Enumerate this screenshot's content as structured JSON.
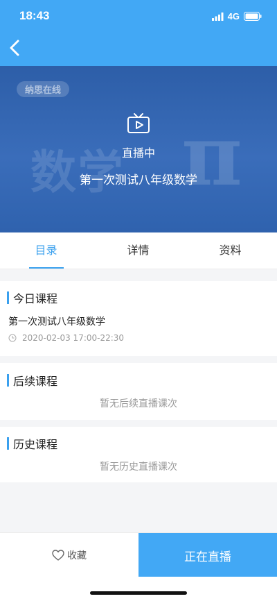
{
  "status_bar": {
    "time": "18:43",
    "network": "4G"
  },
  "banner": {
    "brand": "纳思在线",
    "subject_bg": "数学",
    "symbol_bg": "π",
    "live_label": "直播中",
    "title": "第一次测试八年级数学"
  },
  "tabs": [
    {
      "label": "目录",
      "active": true
    },
    {
      "label": "详情",
      "active": false
    },
    {
      "label": "资料",
      "active": false
    }
  ],
  "today": {
    "title": "今日课程",
    "course_name": "第一次测试八年级数学",
    "course_time": "2020-02-03  17:00-22:30"
  },
  "upcoming": {
    "title": "后续课程",
    "empty_text": "暂无后续直播课次"
  },
  "history": {
    "title": "历史课程",
    "empty_text": "暂无历史直播课次"
  },
  "bottom_bar": {
    "favorite_label": "收藏",
    "live_button_label": "正在直播"
  },
  "colors": {
    "accent": "#42a8f5",
    "tab_active": "#3aa0ee",
    "banner": "#2f62ae"
  }
}
